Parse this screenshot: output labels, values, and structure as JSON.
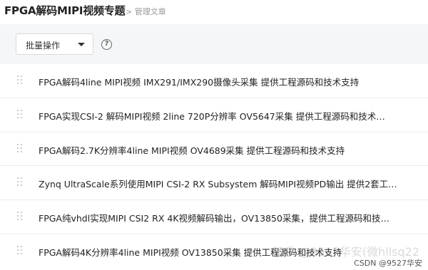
{
  "header": {
    "title": "FPGA解码MIPI视频专题",
    "breadcrumb": "> 管理文章"
  },
  "toolbar": {
    "batch_label": "批量操作",
    "help_symbol": "?"
  },
  "articles": [
    {
      "title": "FPGA解码4line MIPI视频 IMX291/IMX290摄像头采集 提供工程源码和技术支持"
    },
    {
      "title": "FPGA实现CSI-2 解码MIPI视频 2line 720P分辨率 OV5647采集 提供工程源码和技术…"
    },
    {
      "title": "FPGA解码2.7K分辨率4line MIPI视频 OV4689采集 提供工程源码和技术支持"
    },
    {
      "title": "Zynq UltraScale系列使用MIPI CSI-2 RX Subsystem 解码MIPI视频PD输出 提供2套工…"
    },
    {
      "title": "FPGA纯vhdl实现MIPI CSI2 RX 4K视频解码输出，OV13850采集，提供工程源码和技…"
    },
    {
      "title": "FPGA解码4K分辨率4line MIPI视频 OV13850采集 提供工程源码和技术支持"
    }
  ],
  "watermark": {
    "main": "知乎 @9527华安(微hllsq22",
    "sub": "CSDN @9527华安"
  }
}
